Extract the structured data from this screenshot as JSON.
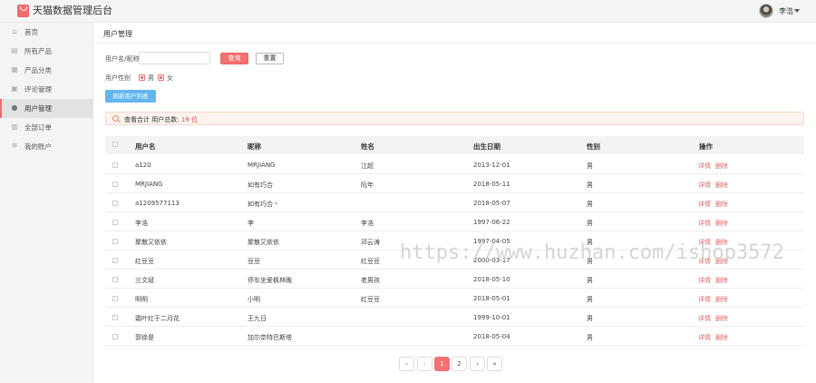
{
  "header": {
    "app_title": "天猫数据管理后台",
    "username": "李浩"
  },
  "sidebar": {
    "items": [
      {
        "label": "首页",
        "icon": "home-icon"
      },
      {
        "label": "所有产品",
        "icon": "product-icon"
      },
      {
        "label": "产品分类",
        "icon": "grid-icon"
      },
      {
        "label": "评论管理",
        "icon": "comment-icon"
      },
      {
        "label": "用户管理",
        "icon": "user-icon",
        "active": true
      },
      {
        "label": "全部订单",
        "icon": "order-icon"
      },
      {
        "label": "我的账户",
        "icon": "gear-icon"
      }
    ]
  },
  "page": {
    "title": "用户管理"
  },
  "filter": {
    "search_label": "用户名/昵称:",
    "search_value": "",
    "query_label": "查询",
    "reset_label": "重置",
    "gender_label": "用户性别",
    "gender_male": "男",
    "gender_female": "女",
    "refresh_label": "刷新用户列表"
  },
  "summary": {
    "prefix": "查看合计 用户总数:",
    "count": "19",
    "suffix": "位"
  },
  "table": {
    "headers": [
      "用户名",
      "昵称",
      "姓名",
      "出生日期",
      "性别",
      "操作"
    ],
    "rows": [
      [
        "a120",
        "MRJIANG",
        "江超",
        "2013-12-01",
        "男"
      ],
      [
        "MRJIANG",
        "如有巧合",
        "阮年",
        "2018-05-11",
        "男"
      ],
      [
        "a1209577113",
        "如有巧合丶",
        "",
        "2018-05-07",
        "男"
      ],
      [
        "李浩",
        "李",
        "李浩",
        "1997-06-22",
        "男"
      ],
      [
        "聚散又依依",
        "聚散又依依",
        "邓云涛",
        "1997-04-05",
        "男"
      ],
      [
        "红豆豆",
        "豆豆",
        "红豆豆",
        "2000-03-17",
        "男"
      ],
      [
        "兰文斌",
        "停车坐爱枫林晚",
        "老男孩",
        "2018-05-10",
        "男"
      ],
      [
        "明明",
        "小明",
        "红豆豆",
        "2018-05-01",
        "男"
      ],
      [
        "霜叶红于二月花",
        "王九日",
        "",
        "1999-10-01",
        "男"
      ],
      [
        "郭徐是",
        "加尔奈特巴斯塔",
        "",
        "2018-05-04",
        "男"
      ]
    ],
    "action_detail": "详情",
    "action_delete": "删除"
  },
  "pagination": {
    "first": "«",
    "prev": "‹",
    "pages": [
      "1",
      "2"
    ],
    "next": "›",
    "last": "»",
    "current": "1"
  },
  "watermark": "https://www.huzhan.com/ishop3572",
  "colors": {
    "accent": "#f27272",
    "refresh": "#65b5ef",
    "summary_bg": "#fdf3ef"
  }
}
